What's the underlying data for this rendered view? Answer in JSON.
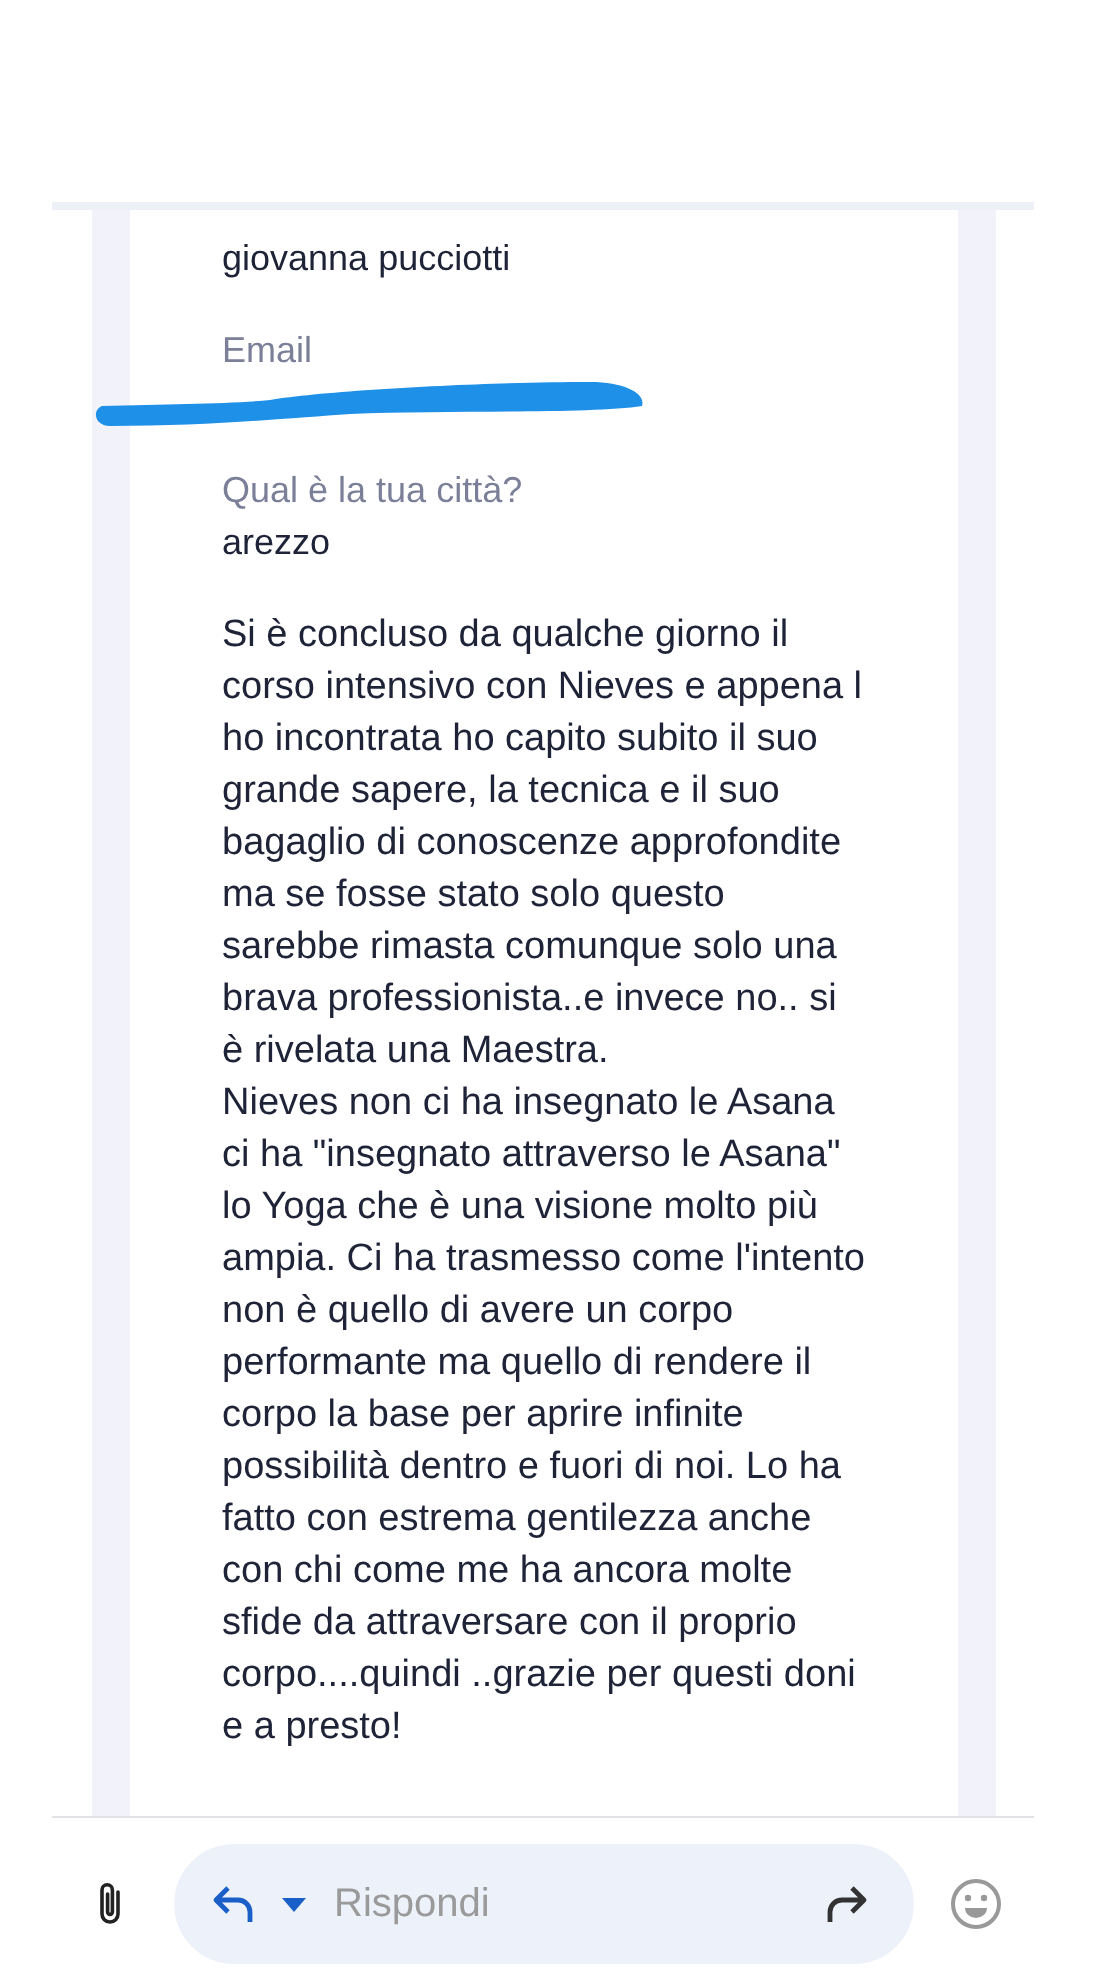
{
  "message": {
    "fields": [
      {
        "kind": "value",
        "text": "giovanna pucciotti"
      },
      {
        "kind": "label",
        "text": "Email"
      },
      {
        "kind": "redacted"
      },
      {
        "kind": "label",
        "text": "Qual è la tua città?"
      },
      {
        "kind": "value",
        "text": "arezzo"
      }
    ],
    "body": [
      "Si è concluso da qualche giorno il corso intensivo con Nieves e appena l ho incontrata ho capito subito il suo grande sapere, la tecnica e il suo bagaglio di conoscenze approfondite ma se fosse stato solo questo sarebbe rimasta comunque solo una brava professionista..e invece no.. si è rivelata una Maestra.",
      "Nieves non ci ha insegnato le Asana ci ha \"insegnato attraverso le Asana\" lo Yoga che è una visione molto più ampia. Ci ha trasmesso come l'intento non è quello di avere un corpo performante ma quello di rendere il corpo la base per aprire infinite possibilità dentro e fuori di noi. Lo ha fatto con estrema gentilezza anche con chi come me ha ancora molte sfide da attraversare con il proprio corpo....quindi ..grazie per questi doni e a presto!"
    ]
  },
  "reply_bar": {
    "placeholder": "Rispondi"
  }
}
